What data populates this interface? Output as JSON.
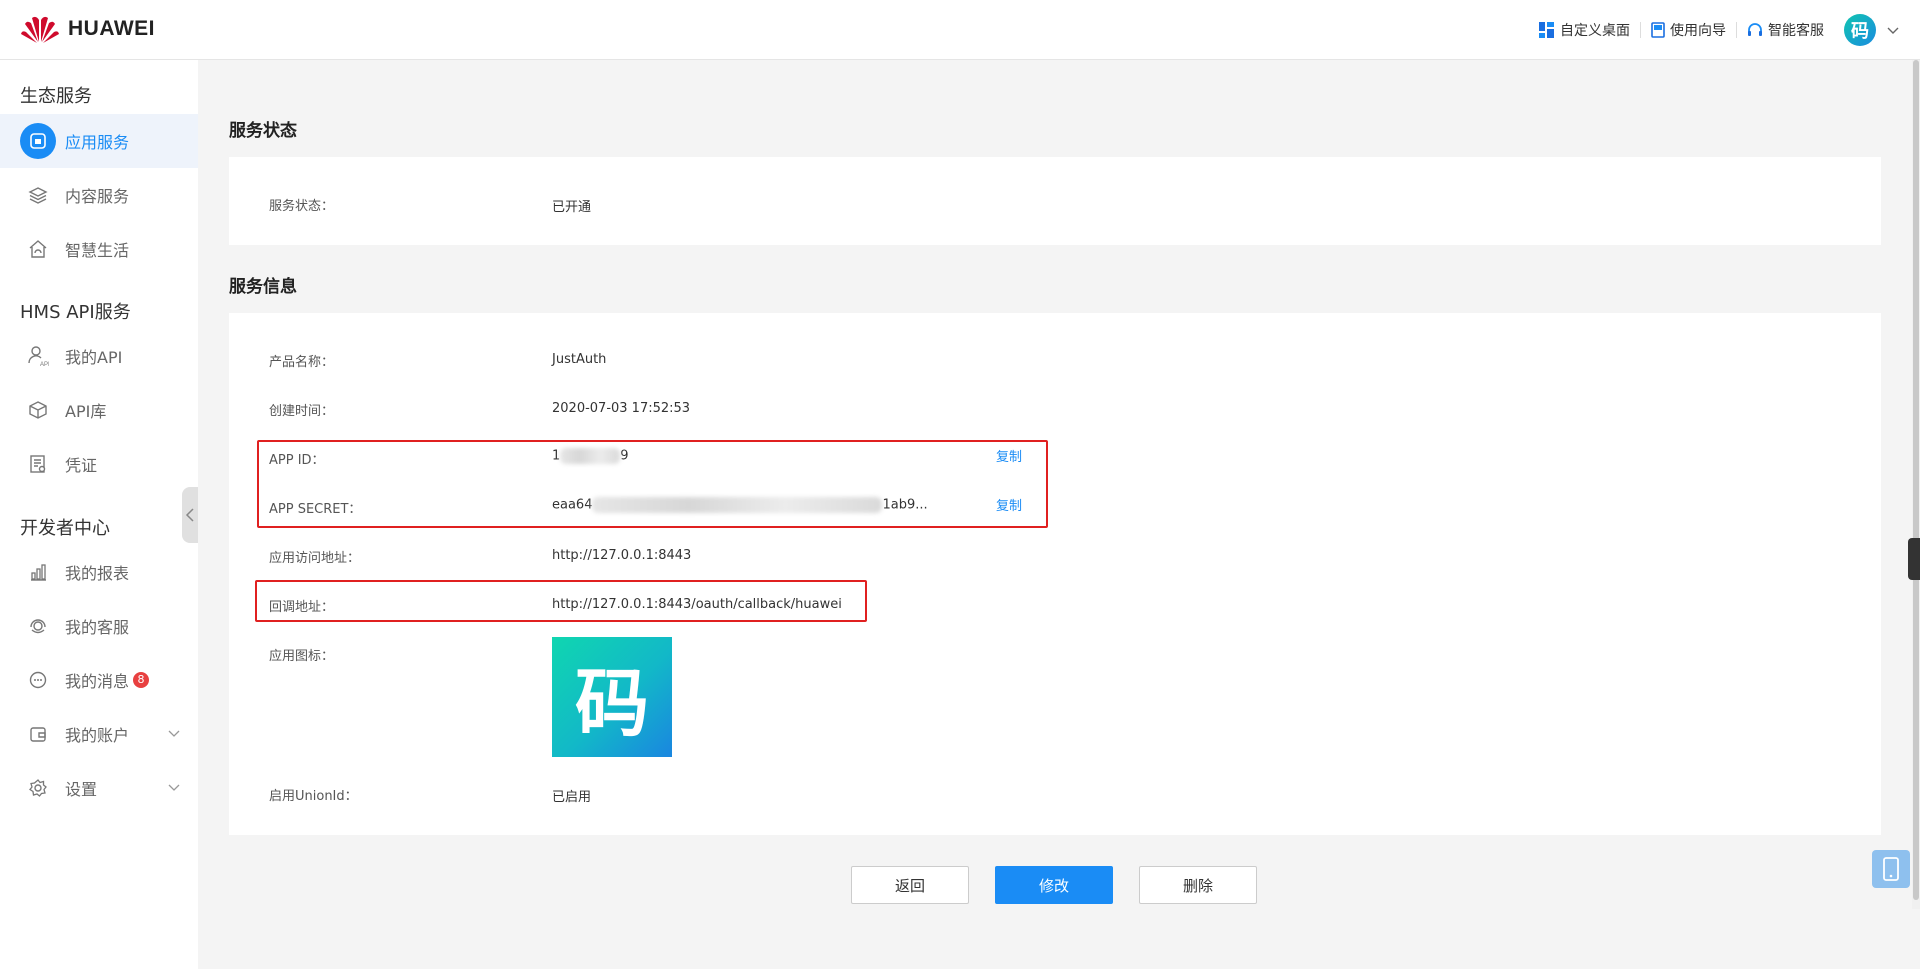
{
  "header": {
    "brand": "HUAWEI",
    "links": [
      {
        "label": "自定义桌面",
        "icon": "grid-icon"
      },
      {
        "label": "使用向导",
        "icon": "guide-book-icon"
      },
      {
        "label": "智能客服",
        "icon": "headset-icon"
      }
    ],
    "avatar_text": "码"
  },
  "sidebar": {
    "sections": [
      {
        "title": "生态服务",
        "items": [
          {
            "label": "应用服务",
            "icon": "app-service-icon",
            "active": true
          },
          {
            "label": "内容服务",
            "icon": "layers-icon"
          },
          {
            "label": "智慧生活",
            "icon": "smart-home-icon"
          }
        ]
      },
      {
        "title": "HMS API服务",
        "items": [
          {
            "label": "我的API",
            "icon": "user-api-icon"
          },
          {
            "label": "API库",
            "icon": "cube-icon"
          },
          {
            "label": "凭证",
            "icon": "credential-icon"
          }
        ]
      },
      {
        "title": "开发者中心",
        "items": [
          {
            "label": "我的报表",
            "icon": "bar-chart-icon"
          },
          {
            "label": "我的客服",
            "icon": "service-icon"
          },
          {
            "label": "我的消息",
            "icon": "message-icon",
            "badge": "8"
          },
          {
            "label": "我的账户",
            "icon": "wallet-icon"
          },
          {
            "label": "设置",
            "icon": "settings-icon"
          }
        ]
      }
    ]
  },
  "main": {
    "status_section": {
      "title": "服务状态",
      "label": "服务状态：",
      "value": "已开通"
    },
    "info_section": {
      "title": "服务信息",
      "product_name_label": "产品名称：",
      "product_name": "JustAuth",
      "created_label": "创建时间：",
      "created": "2020-07-03 17:52:53",
      "app_id_label": "APP ID：",
      "app_id_start": "1",
      "app_id_end": "9",
      "app_secret_label": "APP SECRET：",
      "app_secret_start": "eaa64",
      "app_secret_end": "1ab9...",
      "copy_label": "复制",
      "access_url_label": "应用访问地址：",
      "access_url": "http://127.0.0.1:8443",
      "callback_label": "回调地址：",
      "callback": "http://127.0.0.1:8443/oauth/callback/huawei",
      "icon_label": "应用图标：",
      "icon_glyph": "码",
      "unionid_label": "启用UnionId：",
      "unionid": "已启用"
    },
    "buttons": {
      "back": "返回",
      "edit": "修改",
      "delete": "删除"
    }
  },
  "colors": {
    "accent": "#1a8cf5",
    "highlight_box": "#e02020",
    "badge": "#e84040"
  }
}
